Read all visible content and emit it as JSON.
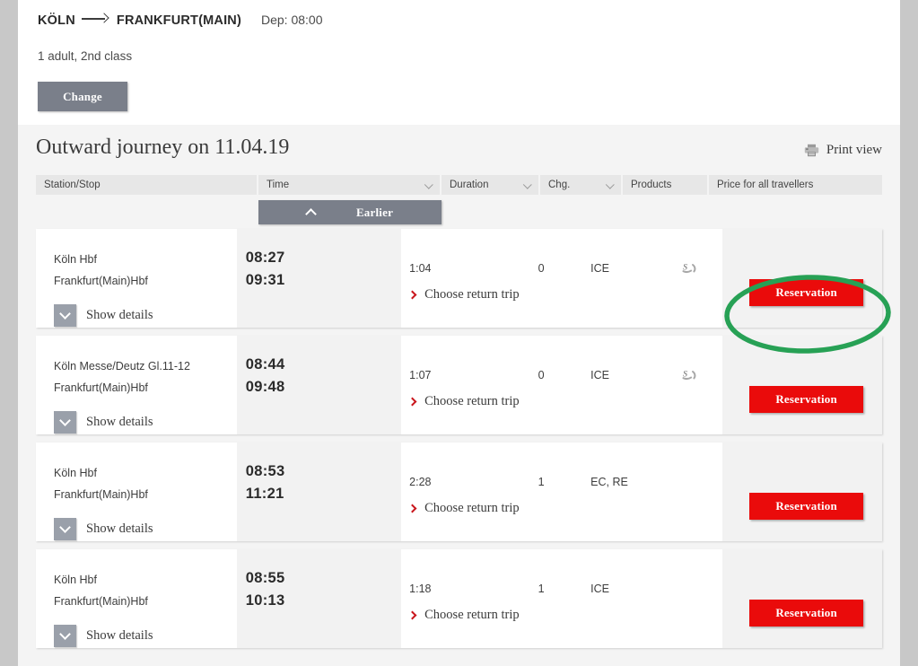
{
  "search_summary": {
    "from": "KÖLN",
    "arrow_icon": "arrow-right-icon",
    "to": "FRANKFURT(MAIN)",
    "departure": "Dep: 08:00",
    "passengers": "1 adult, 2nd class",
    "change_label": "Change"
  },
  "results": {
    "title": "Outward journey on 11.04.19",
    "print_view": {
      "label": "Print view",
      "icon": "printer-icon"
    },
    "earlier_button": {
      "label": "Earlier",
      "icon": "chevron-up-icon"
    },
    "columns": [
      {
        "label": "Station/Stop",
        "sortable": false
      },
      {
        "label": "Time",
        "sortable": true
      },
      {
        "label": "Duration",
        "sortable": true
      },
      {
        "label": "Chg.",
        "sortable": true
      },
      {
        "label": "Products",
        "sortable": false
      },
      {
        "label": "Price for all travellers",
        "sortable": false
      }
    ],
    "details_label": "Show details",
    "return_trip_label": "Choose return trip",
    "reservation_label": "Reservation",
    "connections": [
      {
        "origin": "Köln Hbf",
        "destination": "Frankfurt(Main)Hbf",
        "departure_time": "08:27",
        "arrival_time": "09:31",
        "duration": "1:04",
        "changes": "0",
        "products": "ICE",
        "amenity_icon": "wifi-icon",
        "has_amenity": true,
        "highlighted": true
      },
      {
        "origin": "Köln Messe/Deutz Gl.11-12",
        "destination": "Frankfurt(Main)Hbf",
        "departure_time": "08:44",
        "arrival_time": "09:48",
        "duration": "1:07",
        "changes": "0",
        "products": "ICE",
        "amenity_icon": "wifi-icon",
        "has_amenity": true,
        "highlighted": false
      },
      {
        "origin": "Köln Hbf",
        "destination": "Frankfurt(Main)Hbf",
        "departure_time": "08:53",
        "arrival_time": "11:21",
        "duration": "2:28",
        "changes": "1",
        "products": "EC, RE",
        "amenity_icon": "",
        "has_amenity": false,
        "highlighted": false
      },
      {
        "origin": "Köln Hbf",
        "destination": "Frankfurt(Main)Hbf",
        "departure_time": "08:55",
        "arrival_time": "10:13",
        "duration": "1:18",
        "changes": "1",
        "products": "ICE",
        "amenity_icon": "",
        "has_amenity": false,
        "highlighted": false
      }
    ]
  },
  "annotation": {
    "shape": "ellipse",
    "color": "#27a155",
    "target": "reservation-button-row-1"
  },
  "colors": {
    "accent_red": "#ea0b0b",
    "button_gray": "#7a7f8a",
    "annotation_green": "#27a155",
    "page_bg": "#f4f4f4",
    "outer_bg": "#c8c8c8"
  }
}
